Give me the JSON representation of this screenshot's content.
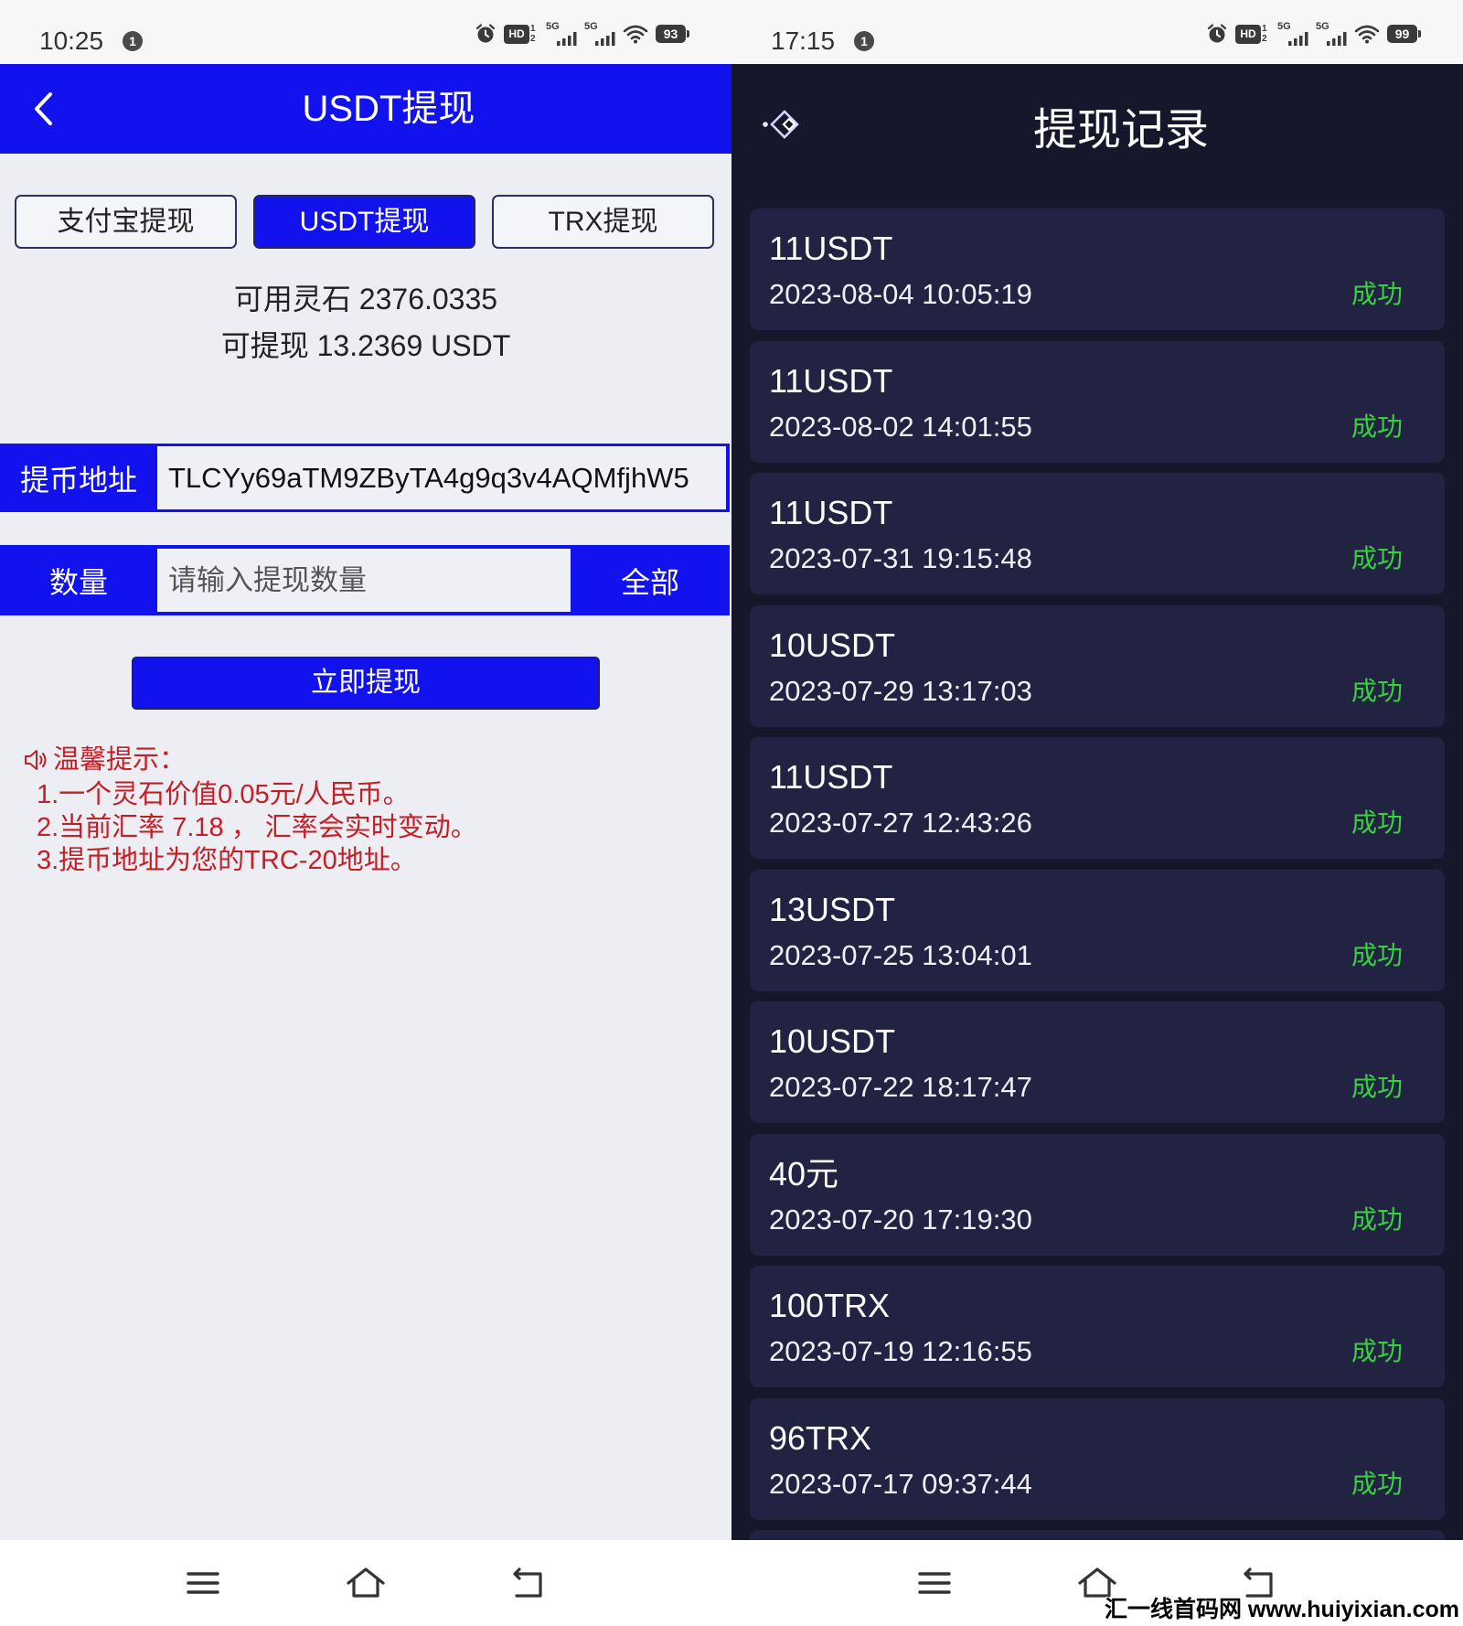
{
  "colors": {
    "primary_blue": "#1212ee",
    "success_green": "#36d23c",
    "tip_red": "#c41e26",
    "dark_bg": "#16172b",
    "card_bg": "#222342"
  },
  "withdraw_screen": {
    "status_bar": {
      "time": "10:25",
      "notification_count": "1",
      "hd_label": "HD",
      "hd_top": "1",
      "hd_bottom": "2",
      "sim1_label": "5G",
      "sim2_label": "5G",
      "battery": "93"
    },
    "header": {
      "title": "USDT提现",
      "back_icon": "chevron-left-icon"
    },
    "tabs": [
      {
        "label": "支付宝提现",
        "active": false
      },
      {
        "label": "USDT提现",
        "active": true
      },
      {
        "label": "TRX提现",
        "active": false
      }
    ],
    "balance": {
      "spirit_stone": "可用灵石 2376.0335",
      "withdrawable": "可提现 13.2369 USDT"
    },
    "address": {
      "label": "提币地址",
      "value": "TLCYy69aTM9ZByTA4g9q3v4AQMfjhW5"
    },
    "amount": {
      "label": "数量",
      "placeholder": "请输入提现数量",
      "all_label": "全部"
    },
    "submit_label": "立即提现",
    "tips": {
      "icon": "speaker-icon",
      "title": "温馨提示：",
      "lines": [
        "1.一个灵石价值0.05元/人民币。",
        "2.当前汇率 7.18 ， 汇率会实时变动。",
        "3.提币地址为您的TRC-20地址。"
      ]
    }
  },
  "records_screen": {
    "status_bar": {
      "time": "17:15",
      "notification_count": "1",
      "hd_label": "HD",
      "hd_top": "1",
      "hd_bottom": "2",
      "sim1_label": "5G",
      "sim2_label": "5G",
      "battery": "99"
    },
    "header": {
      "title": "提现记录",
      "back_icon": "diamond-arrow-icon"
    },
    "records": [
      {
        "amount": "11USDT",
        "time": "2023-08-04 10:05:19",
        "status": "成功"
      },
      {
        "amount": "11USDT",
        "time": "2023-08-02 14:01:55",
        "status": "成功"
      },
      {
        "amount": "11USDT",
        "time": "2023-07-31 19:15:48",
        "status": "成功"
      },
      {
        "amount": "10USDT",
        "time": "2023-07-29 13:17:03",
        "status": "成功"
      },
      {
        "amount": "11USDT",
        "time": "2023-07-27 12:43:26",
        "status": "成功"
      },
      {
        "amount": "13USDT",
        "time": "2023-07-25 13:04:01",
        "status": "成功"
      },
      {
        "amount": "10USDT",
        "time": "2023-07-22 18:17:47",
        "status": "成功"
      },
      {
        "amount": "40元",
        "time": "2023-07-20 17:19:30",
        "status": "成功"
      },
      {
        "amount": "100TRX",
        "time": "2023-07-19 12:16:55",
        "status": "成功"
      },
      {
        "amount": "96TRX",
        "time": "2023-07-17 09:37:44",
        "status": "成功"
      }
    ]
  },
  "nav_bar": {
    "icons": [
      "menu-icon",
      "home-icon",
      "back-icon"
    ]
  },
  "watermark": "汇一线首码网 www.huiyixian.com"
}
